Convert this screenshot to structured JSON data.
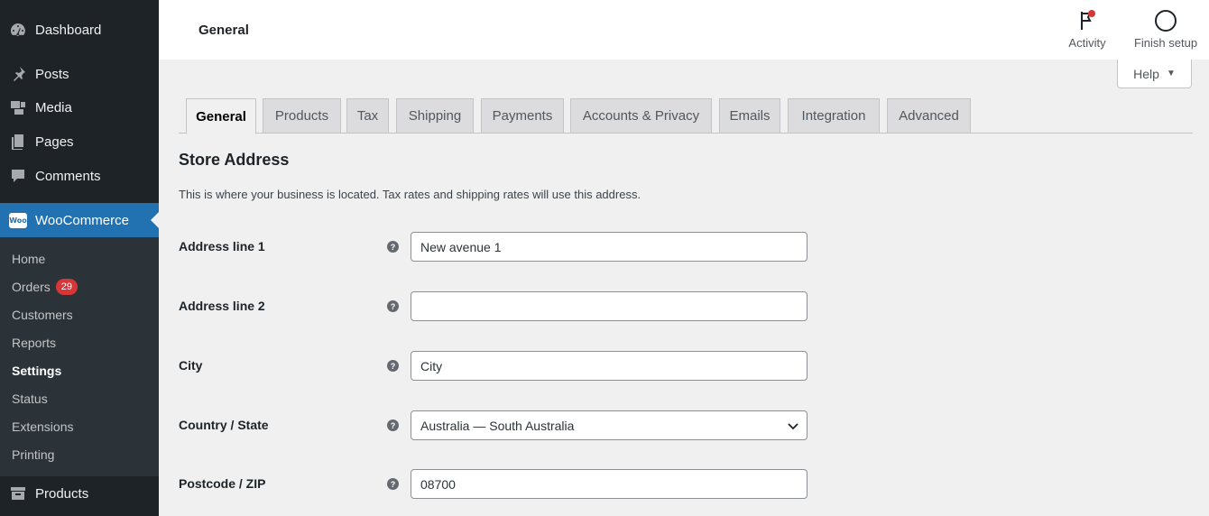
{
  "sidebar": {
    "top_items": [
      {
        "label": "Dashboard",
        "icon": "dashboard-icon"
      },
      {
        "label": "Posts",
        "icon": "pin-icon"
      },
      {
        "label": "Media",
        "icon": "media-icon"
      },
      {
        "label": "Pages",
        "icon": "pages-icon"
      },
      {
        "label": "Comments",
        "icon": "comment-icon"
      }
    ],
    "woocommerce": {
      "label": "WooCommerce",
      "badge_text": "Woo"
    },
    "submenu": [
      {
        "label": "Home"
      },
      {
        "label": "Orders",
        "badge": "29"
      },
      {
        "label": "Customers"
      },
      {
        "label": "Reports"
      },
      {
        "label": "Settings"
      },
      {
        "label": "Status"
      },
      {
        "label": "Extensions"
      },
      {
        "label": "Printing"
      }
    ],
    "products": {
      "label": "Products",
      "icon": "archive-icon"
    }
  },
  "header": {
    "title": "General",
    "activity_label": "Activity",
    "finish_setup_label": "Finish setup",
    "help_label": "Help"
  },
  "tabs": [
    {
      "label": "General",
      "active": true
    },
    {
      "label": "Products"
    },
    {
      "label": "Tax"
    },
    {
      "label": "Shipping"
    },
    {
      "label": "Payments"
    },
    {
      "label": "Accounts & Privacy"
    },
    {
      "label": "Emails"
    },
    {
      "label": "Integration"
    },
    {
      "label": "Advanced"
    }
  ],
  "section": {
    "title": "Store Address",
    "description": "This is where your business is located. Tax rates and shipping rates will use this address."
  },
  "fields": [
    {
      "label": "Address line 1",
      "value": "New avenue 1"
    },
    {
      "label": "Address line 2",
      "value": ""
    },
    {
      "label": "City",
      "value": "City"
    },
    {
      "label": "Country / State",
      "value": "Australia — South Australia"
    },
    {
      "label": "Postcode / ZIP",
      "value": "08700"
    }
  ],
  "colors": {
    "accent": "#2271b1",
    "sidebar_bg": "#1d2327",
    "badge_red": "#d63638"
  }
}
